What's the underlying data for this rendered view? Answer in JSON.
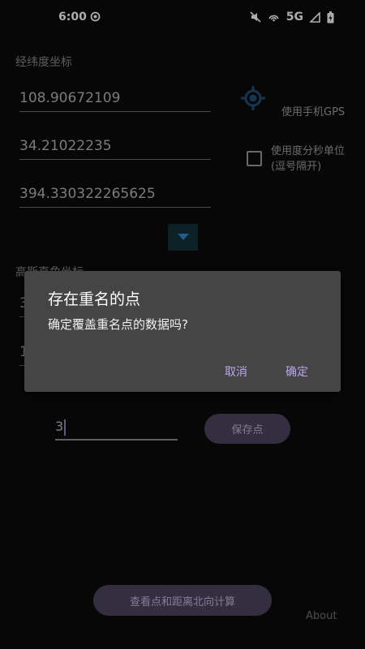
{
  "status_bar": {
    "time": "6:00",
    "network": "5G"
  },
  "coords": {
    "section_title": "经纬度坐标",
    "longitude": "108.90672109",
    "latitude": "34.21022235",
    "altitude": "394.330322265625",
    "gps_label": "使用手机GPS",
    "dms_label_line1": "使用度分秒单位",
    "dms_label_line2": "(逗号隔开)",
    "dms_checked": false
  },
  "gauss": {
    "section_title": "高斯直角坐标",
    "x_value_partial": "3",
    "y_value_partial": "1"
  },
  "save": {
    "input_value": "3",
    "button_label": "保存点"
  },
  "footer": {
    "view_button_label": "查看点和距离北向计算",
    "about_label": "About"
  },
  "dialog": {
    "title": "存在重名的点",
    "message": "确定覆盖重名点的数据吗?",
    "cancel_label": "取消",
    "ok_label": "确定"
  },
  "colors": {
    "accent": "#b9a6f0",
    "button_bg": "#4d4460",
    "dialog_bg": "#454545",
    "gps_icon": "#1f4f7a"
  }
}
